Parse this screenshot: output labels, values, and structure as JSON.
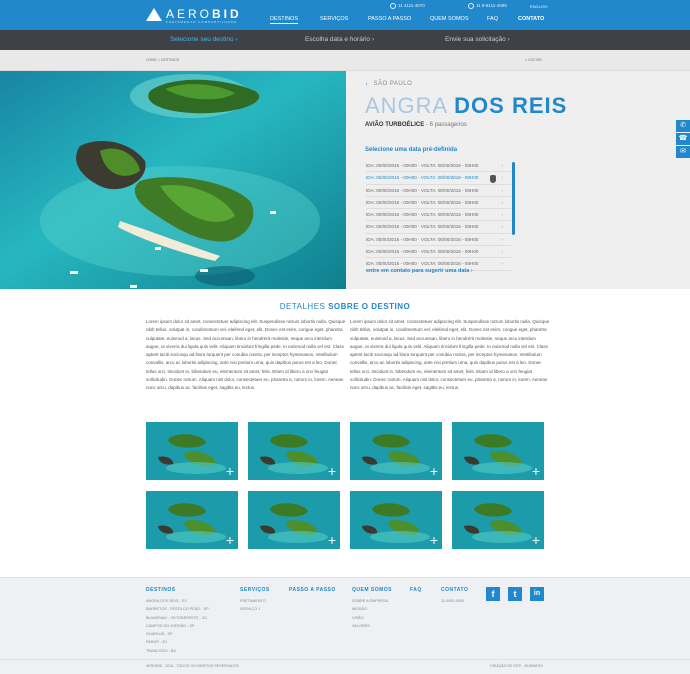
{
  "header": {
    "logo_text_1": "AERO",
    "logo_text_2": "BID",
    "logo_sub": "FRETAMENTO COMPARTILHADO",
    "phone": "11 4111-4070",
    "whatsapp": "11 9-8111-4999",
    "language": "ENGLISH",
    "nav": [
      "DESTINOS",
      "SERVIÇOS",
      "PASSO A PASSO",
      "QUEM SOMOS",
      "FAQ",
      "CONTATO"
    ],
    "accent": "#2188cb"
  },
  "steps": [
    "Selecione seu destino",
    "Escolha data e horário",
    "Envie sua solicitação"
  ],
  "breadcrumb": "HOME > DESTINOS",
  "back": "< VOLTAR",
  "destination": {
    "city": "SÃO PAULO",
    "name_1": "ANGRA",
    "name_2": "DOS REIS",
    "aircraft": "AVIÃO TURBOÉLICE",
    "passengers": " - 6 passageiros",
    "select_title": "Selecione uma data pré-definida",
    "dates": [
      "IDA: 00/00/2016 - 00H00  ·  VOLTA: 00/00/2016 - 00H00",
      "IDA: 00/00/2016 - 00H00  ·  VOLTA: 00/00/2016 - 00H00",
      "IDA: 00/00/2016 - 00H00  ·  VOLTA: 00/00/2016 - 00H00",
      "IDA: 00/00/2016 - 00H00  ·  VOLTA: 00/00/2016 - 00H00",
      "IDA: 00/00/2016 - 00H00  ·  VOLTA: 00/00/2016 - 00H00",
      "IDA: 00/00/2016 - 00H00  ·  VOLTA: 00/00/2016 - 00H00",
      "IDA: 00/00/2016 - 00H00  ·  VOLTA: 00/00/2016 - 00H00",
      "IDA: 00/00/2016 - 00H00  ·  VOLTA: 00/00/2016 - 00H00",
      "IDA: 00/00/2016 - 00H00  ·  VOLTA: 00/00/2016 - 00H00"
    ],
    "contact_link": "entre em contato para sugerir uma data"
  },
  "details": {
    "title_1": "DETALHES ",
    "title_2": "SOBRE O DESTINO",
    "paragraph_1": "Lorem ipsum dolor sit amet, consectetuer adipiscing elit. Suspendisse rutrum lobortis nulla. Quisque nibh tellus, volutpat in, condimentum vel, eleifend eget, elit. Donec est enim, congue eget, pharetra vulputate, euismod a, lacus. Sed accumsan, libero in hendrerit molestie, neque arcu interdum augue, ut viverra dui ligula quis velit. Aliquam tincidunt fringilla pede. In euismod nulla vel est. Class aptent taciti sociosqu ad litora torquent per conubia nostra, per inceptos hymenaeos. Vestibulum convallis, arcu ac lobortis adipiscing, ante nisi pretium urna, quis dapibus purus est a leo. Donec tellus orci, tincidunt in, bibendum eu, elementum sit amet, felis. Etiam id libero a orci feugiat sollicitudin. Donec rutrum. Aliquam nisl dolor, consectetuer eu, pharetra a, rutrum in, lorem. Aenean nunc arcu, dapibus ac, facilisis eget, sagittis eu, lectus.",
    "paragraph_2": "Lorem ipsum dolor sit amet, consectetuer adipiscing elit. Suspendisse rutrum lobortis nulla. Quisque nibh tellus, volutpat in, condimentum vel, eleifend eget, elit. Donec est enim, congue eget, pharetra vulputate, euismod a, lacus. Sed accumsan, libero in hendrerit molestie, neque arcu interdum augue, ut viverra dui ligula quis velit. Aliquam tincidunt fringilla pede. In euismod nulla vel est. Class aptent taciti sociosqu ad litora torquent per conubia nostra, per inceptos hymenaeos. Vestibulum convallis, arcu ac lobortis adipiscing, ante nisi pretium urna, quis dapibus purus est a leo. Donec tellus orci, tincidunt in, bibendum eu, elementum sit amet, felis. Etiam id libero a orci feugiat sollicitudin. Donec rutrum. Aliquam nisl dolor, consectetuer eu, pharetra a, rutrum in, lorem. Aenean nunc arcu, dapibus ac, facilisis eget, sagittis eu, lectus."
  },
  "gallery_plus": "+",
  "footer": {
    "destinos_title": "DESTINOS",
    "destinos": [
      "ANGRA DOS REIS - RJ",
      "BARRETOS - FESTA DO PEÃO - SP",
      "BLUMENAU - OKTOBERFEST - SC",
      "CAMPOS DO JORDÃO - SP",
      "GUARUJÁ - SP",
      "PARATI - RJ",
      "TRANCOSO - BA"
    ],
    "servicos_title": "SERVIÇOS",
    "servicos": [
      "FRETAMENTO",
      "SERVIÇO 1"
    ],
    "passo_title": "PASSO A PASSO",
    "quem_title": "QUEM SOMOS",
    "quem": [
      "SOBRE A EMPRESA",
      "MISSÃO",
      "VISÃO",
      "VALORES"
    ],
    "faq_title": "FAQ",
    "contato_title": "CONTATO",
    "contato": [
      "11 0000-0000"
    ],
    "social": [
      "f",
      "t",
      "in"
    ],
    "copyright": "AEROBID - 2016 - TODOS OS DIREITOS RESERVADOS",
    "credit": "CRIAÇÃO DE SITE - BUSINESS"
  },
  "side_icons": [
    "whatsapp-icon",
    "phone-icon",
    "mail-icon"
  ]
}
